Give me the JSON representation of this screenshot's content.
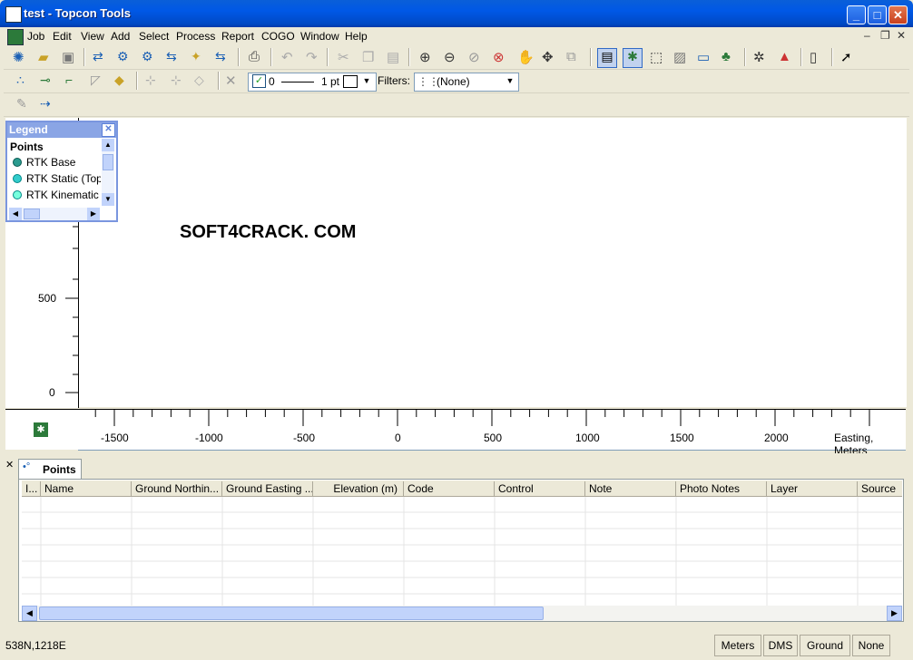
{
  "window": {
    "title": "test - Topcon Tools"
  },
  "menu": [
    "Job",
    "Edit",
    "View",
    "Add",
    "Select",
    "Process",
    "Report",
    "COGO",
    "Window",
    "Help"
  ],
  "toolbar2": {
    "line_width_value": "0",
    "pt_label": "1 pt",
    "filters_label": "Filters:",
    "filters_value": "(None)"
  },
  "legend": {
    "title": "Legend",
    "section": "Points",
    "items": [
      "RTK Base",
      "RTK Static (Topo",
      "RTK Kinematic (A"
    ]
  },
  "plot": {
    "watermark": "SOFT4CRACK. COM",
    "y_ticks": [
      "500",
      "0"
    ],
    "x_ticks": [
      "-1500",
      "-1000",
      "-500",
      "0",
      "500",
      "1000",
      "1500",
      "2000"
    ],
    "x_axis_label": "Easting, Meters"
  },
  "points_panel": {
    "tab_label": "Points",
    "columns": [
      "I...",
      "Name",
      "Ground Northin...",
      "Ground Easting ...",
      "Elevation (m)",
      "Code",
      "Control",
      "Note",
      "Photo Notes",
      "Layer",
      "Source"
    ]
  },
  "status": {
    "coords": "538N,1218E",
    "units": "Meters",
    "angle": "DMS",
    "mode": "Ground",
    "extra": "None"
  },
  "colors": {
    "title_bar": "#0058e6",
    "legend_header": "#8aa5e5",
    "canvas": "#ffffff"
  }
}
